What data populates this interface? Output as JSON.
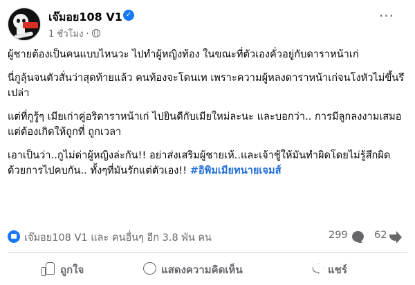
{
  "post": {
    "page_name": "เจ๊มอย108 V1",
    "timestamp": "1 ชั่วโมง",
    "meta_separator": "·",
    "paragraphs": [
      "ผู้ชายต้องเป็นคนแบบไหนวะ ไปทำผู้หญิงท้อง ในขณะที่ตัวเองคั่วอยู่กับดาราหน้าเก่",
      "นี่กูลุ้นจนตัวสั่นว่าสุดท้ายแล้ว คนท้องจะโดนเท เพราะความผู้หลงดาราหน้าเก่จนโงหัวไม่ขึ้นรึเปล่า",
      "แต่ที่กูรู้ๆ เมียเก่าคู่อริดาราหน้าเก่ ไปยินดีกับเมียใหม่ละนะ และบอกว่า.. การมีลูกลงงามเสมอ แต่ต้องเกิดให้ถูกที่ ถูกเวลา"
    ],
    "last_paragraph_text": "เอาเป็นว่า..กูไม่ด่าผู้หญิงล่ะกัน!! อย่าส่งเสริมผู้ชายเห้..และเจ้าชู้ให้มันทำผิดโดยไม่รู้สึกผิด ด้วยการไปคบกัน.. ทั้งๆที่มันรักแต่ตัวเอง!!",
    "hashtag": "#อิพิมเมียทนายเจมส์"
  },
  "reactions": {
    "summary": "เจ๊มอย108 V1 และ คนอื่นๆ อีก 3.8 พัน คน",
    "comment_count": "299",
    "share_count": "62"
  },
  "actions": {
    "like": "ถูกใจ",
    "comment": "แสดงความคิดเห็น",
    "share": "แชร์"
  },
  "colors": {
    "accent": "#1877f2",
    "hashtag": "#216fdb",
    "secondary_text": "#65676b"
  }
}
